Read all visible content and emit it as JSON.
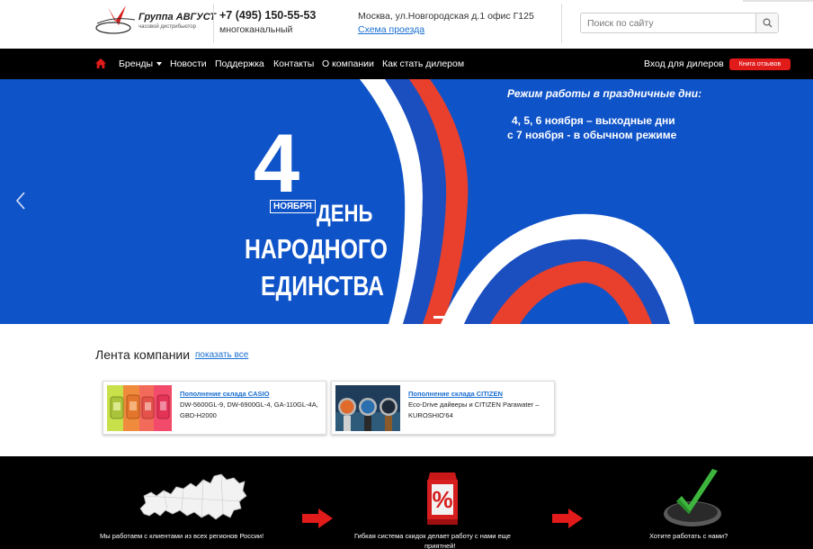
{
  "header": {
    "logo_title": "Группа АВГУСТ",
    "logo_subtitle": "часовой дистрибьютор",
    "phone": "+7 (495) 150-55-53",
    "phone_note": "многоканальный",
    "address": "Москва, ул.Новгородская д.1 офис Г125",
    "route_link": "Схема проезда",
    "search_placeholder": "Поиск по сайту"
  },
  "nav": {
    "items": [
      "Бренды",
      "Новости",
      "Поддержка",
      "Контакты",
      "О компании",
      "Как стать дилером"
    ],
    "dealer_login": "Вход для дилеров",
    "reviews_button": "Книга отзывов"
  },
  "banner": {
    "big_number": "4",
    "month": "НОЯБРЯ",
    "line1": "ДЕНЬ",
    "line2": "НАРОДНОГО",
    "line3": "ЕДИНСТВА",
    "schedule_title": "Режим работы в праздничные дни:",
    "schedule_line1": "4, 5, 6  ноября – выходные дни",
    "schedule_line2": "с 7 ноября  - в обычном режиме"
  },
  "feed": {
    "title": "Лента компании",
    "show_all": "показать все",
    "cards": [
      {
        "title": "Пополнение склада CASIO",
        "text": "DW-5600GL-9, DW-6900GL-4, GA-110GL-4A, GBD-H2000"
      },
      {
        "title": "Пополнение склада CITIZEN",
        "text": "Eco-Drive дайверы и CITIZEN Parawater – KUROSHIO'64"
      }
    ]
  },
  "bottom": {
    "caption1": "Мы работаем с клиентами из всех регионов России!",
    "caption2_line1": "Гибкая система скидок делает работу с нами еще",
    "caption2_line2": "приятней!",
    "caption3": "Хотите работать с нами?",
    "percent_sign": "%"
  },
  "colors": {
    "accent_red": "#e11a1a",
    "banner_blue": "#0f53c8",
    "link_blue": "#1a6fd1",
    "nav_black": "#000000"
  },
  "icons": [
    "logo-mark",
    "search-icon",
    "home-icon",
    "caret-down-icon",
    "chevron-left-icon",
    "russia-map-icon",
    "red-arrow-icon",
    "discount-box-icon",
    "checkmark-icon"
  ]
}
